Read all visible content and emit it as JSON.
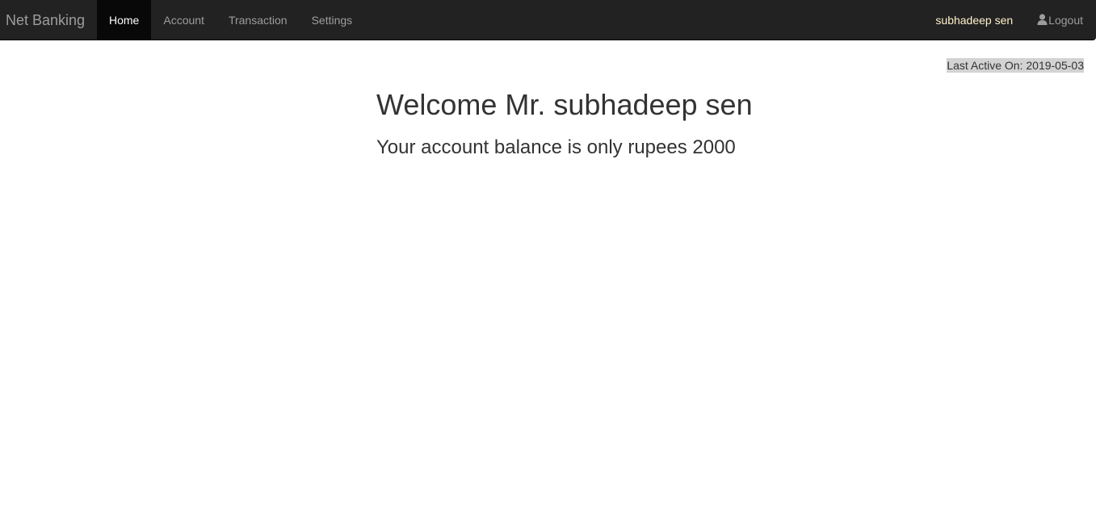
{
  "navbar": {
    "brand": "Net Banking",
    "items": [
      {
        "label": "Home",
        "active": true
      },
      {
        "label": "Account",
        "active": false
      },
      {
        "label": "Transaction",
        "active": false
      },
      {
        "label": "Settings",
        "active": false
      }
    ],
    "user_name": "subhadeep sen",
    "logout_label": "Logout",
    "logout_icon": "user-icon"
  },
  "main": {
    "last_active": "Last Active On: 2019-05-03",
    "welcome": "Welcome Mr. subhadeep sen",
    "balance": "Your account balance is only rupees 2000"
  },
  "colors": {
    "navbar_bg": "#222222",
    "active_bg": "#080808",
    "nav_text": "#9d9d9d",
    "user_text": "#fff1c9",
    "last_active_bg": "#d3d3d3"
  }
}
